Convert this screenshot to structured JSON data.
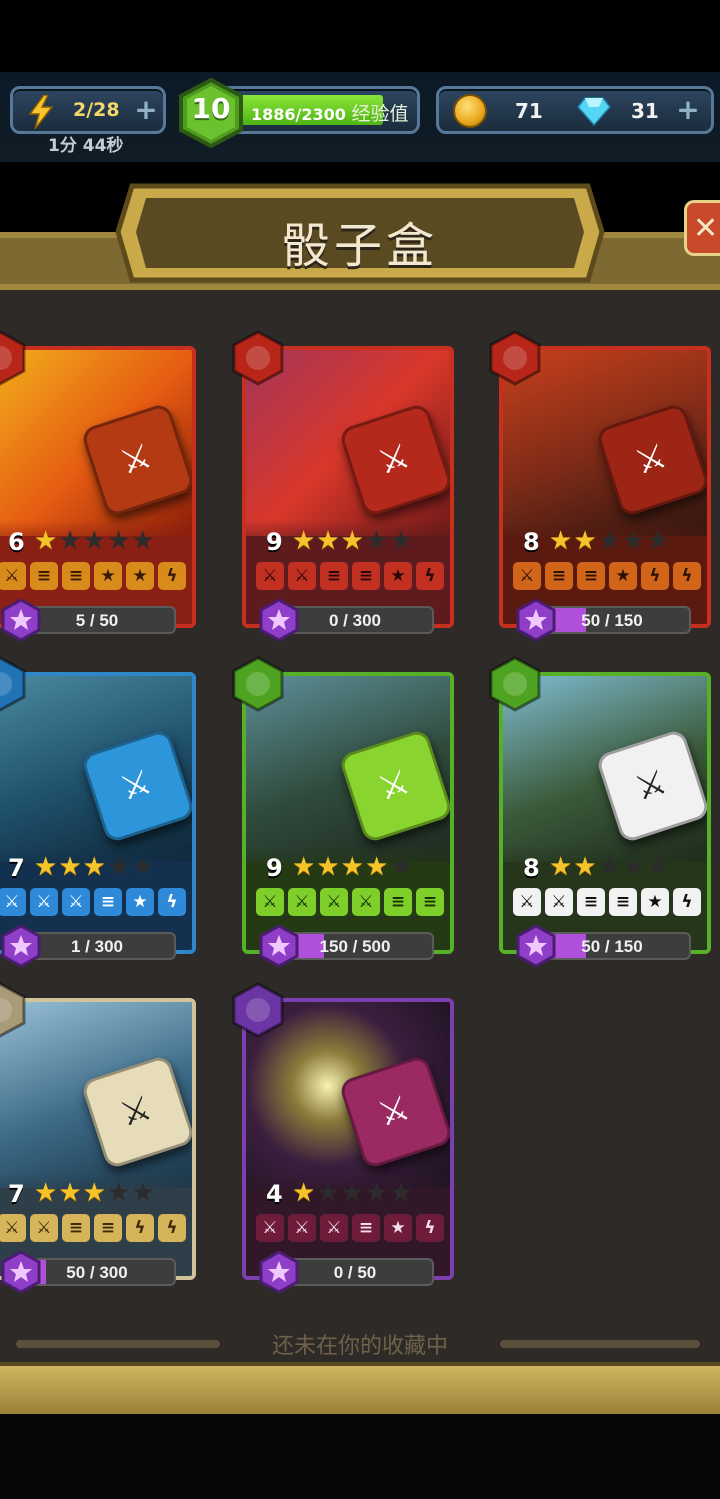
{
  "status": {
    "energy": "2/28",
    "energy_timer": "1分 44秒",
    "level": "10",
    "xp_text": "1886/2300",
    "xp_label": "经验值",
    "xp_fraction": 0.82,
    "coins": "71",
    "gems": "31"
  },
  "title": "骰子盒",
  "footer": "还未在你的收藏中",
  "cards": [
    {
      "level": "6",
      "stars": 1,
      "progress": "5 / 50",
      "fraction": 0.1
    },
    {
      "level": "9",
      "stars": 3,
      "progress": "0 / 300",
      "fraction": 0
    },
    {
      "level": "8",
      "stars": 2,
      "progress": "50 / 150",
      "fraction": 0.33
    },
    {
      "level": "7",
      "stars": 3,
      "progress": "1 / 300",
      "fraction": 0.01
    },
    {
      "level": "9",
      "stars": 4,
      "progress": "150 / 500",
      "fraction": 0.3
    },
    {
      "level": "8",
      "stars": 2,
      "progress": "50 / 150",
      "fraction": 0.33
    },
    {
      "level": "7",
      "stars": 3,
      "progress": "50 / 300",
      "fraction": 0.17
    },
    {
      "level": "4",
      "stars": 1,
      "progress": "0 / 50",
      "fraction": 0
    }
  ],
  "colors": {
    "fire": "#c7301f",
    "water": "#2f86c8",
    "nature": "#56b128",
    "neutral": "#d2c49a",
    "shadow": "#7c3fb0"
  }
}
